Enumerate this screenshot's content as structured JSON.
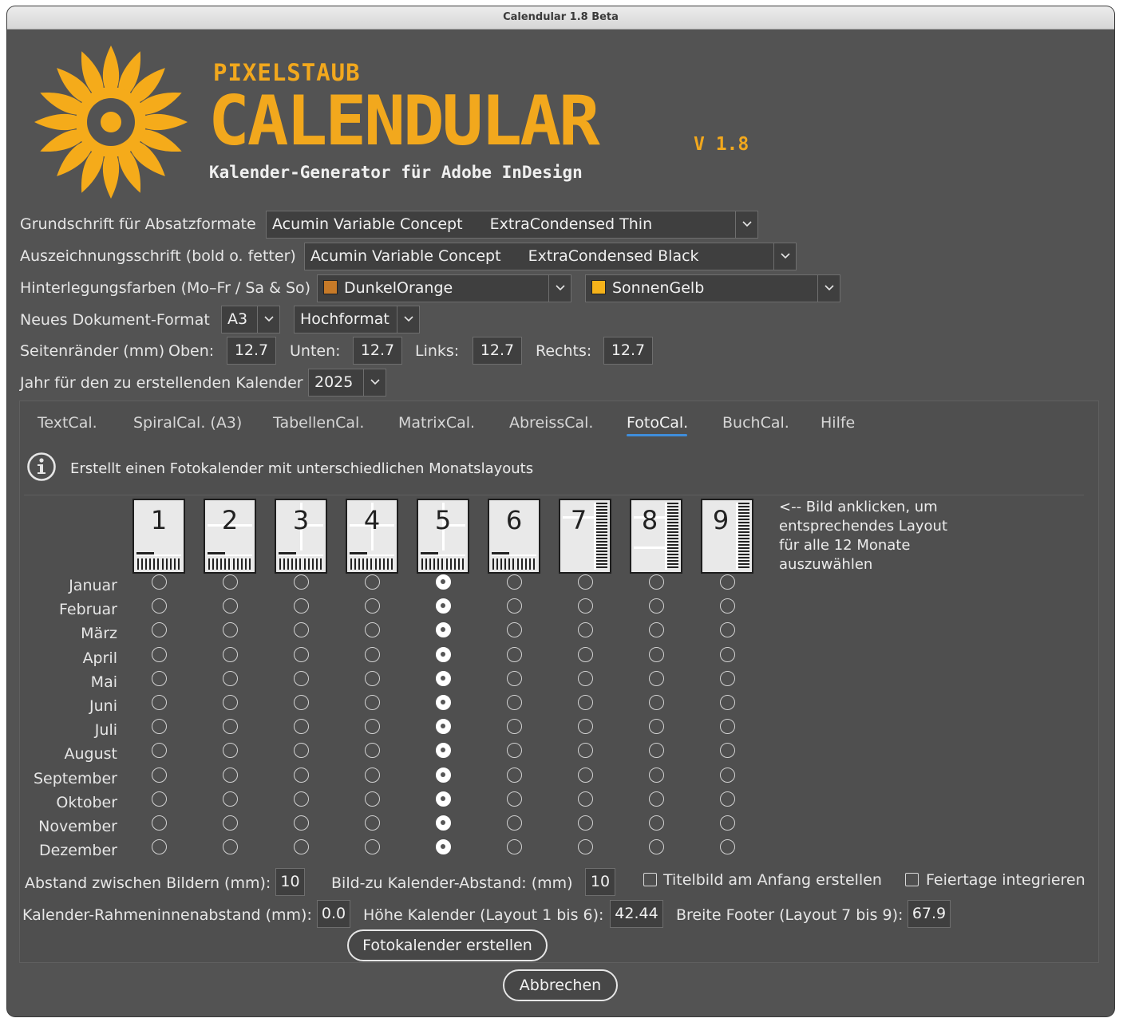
{
  "window": {
    "title": "Calendular 1.8 Beta"
  },
  "brand": {
    "maker": "PIXELSTAUB",
    "name": "CALENDULAR",
    "version": "V 1.8",
    "subtitle": "Kalender-Generator für Adobe InDesign",
    "accent_color": "#f2a81d",
    "logo_icon": "calendula-flower-icon"
  },
  "settings": {
    "base_font": {
      "label": "Grundschrift für Absatzformate",
      "family": "Acumin Variable Concept",
      "style": "ExtraCondensed Thin"
    },
    "bold_font": {
      "label": "Auszeichnungsschrift (bold o. fetter)",
      "family": "Acumin Variable Concept",
      "style": "ExtraCondensed Black"
    },
    "colors": {
      "label": "Hinterlegungsfarben (Mo–Fr / Sa & So)",
      "weekday": {
        "name": "DunkelOrange",
        "swatch": "#c77a28"
      },
      "weekend": {
        "name": "SonnenGelb",
        "swatch": "#f5b21a"
      }
    },
    "document": {
      "label": "Neues Dokument-Format",
      "size": "A3",
      "orientation": "Hochformat"
    },
    "margins": {
      "label": "Seitenränder (mm)",
      "top_label": "Oben:",
      "top": "12.7",
      "bottom_label": "Unten:",
      "bottom": "12.7",
      "left_label": "Links:",
      "left": "12.7",
      "right_label": "Rechts:",
      "right": "12.7"
    },
    "year": {
      "label": "Jahr für den zu erstellenden Kalender",
      "value": "2025"
    }
  },
  "tabs": [
    {
      "label": "TextCal.",
      "active": false
    },
    {
      "label": "SpiralCal. (A3)",
      "active": false
    },
    {
      "label": "TabellenCal.",
      "active": false
    },
    {
      "label": "MatrixCal.",
      "active": false
    },
    {
      "label": "AbreissCal.",
      "active": false
    },
    {
      "label": "FotoCal.",
      "active": true
    },
    {
      "label": "BuchCal.",
      "active": false
    },
    {
      "label": "Hilfe",
      "active": false
    }
  ],
  "fotocal": {
    "info": "Erstellt einen Fotokalender mit unterschiedlichen Monatslayouts",
    "info_icon": "info-icon",
    "layouts": [
      "1",
      "2",
      "3",
      "4",
      "5",
      "6",
      "7",
      "8",
      "9"
    ],
    "hint_lines": [
      "<-- Bild anklicken, um",
      "entsprechendes Layout",
      "für alle 12 Monate",
      "auszuwählen"
    ],
    "months": [
      "Januar",
      "Februar",
      "März",
      "April",
      "Mai",
      "Juni",
      "Juli",
      "August",
      "September",
      "Oktober",
      "November",
      "Dezember"
    ],
    "selected_layout": 5,
    "options": {
      "image_gap_label": "Abstand zwischen Bildern (mm):",
      "image_gap": "10",
      "image_cal_gap_label": "Bild-zu Kalender-Abstand: (mm)",
      "image_cal_gap": "10",
      "title_image_label": "Titelbild am Anfang erstellen",
      "title_image_checked": false,
      "holidays_label": "Feiertage integrieren",
      "holidays_checked": false,
      "frame_inset_label": "Kalender-Rahmeninnenabstand (mm):",
      "frame_inset": "0.0",
      "cal_height_label": "Höhe Kalender (Layout 1 bis 6):",
      "cal_height": "42.44",
      "footer_width_label": "Breite Footer (Layout 7 bis 9):",
      "footer_width": "67.9"
    },
    "create_button": "Fotokalender erstellen"
  },
  "cancel_button": "Abbrechen"
}
